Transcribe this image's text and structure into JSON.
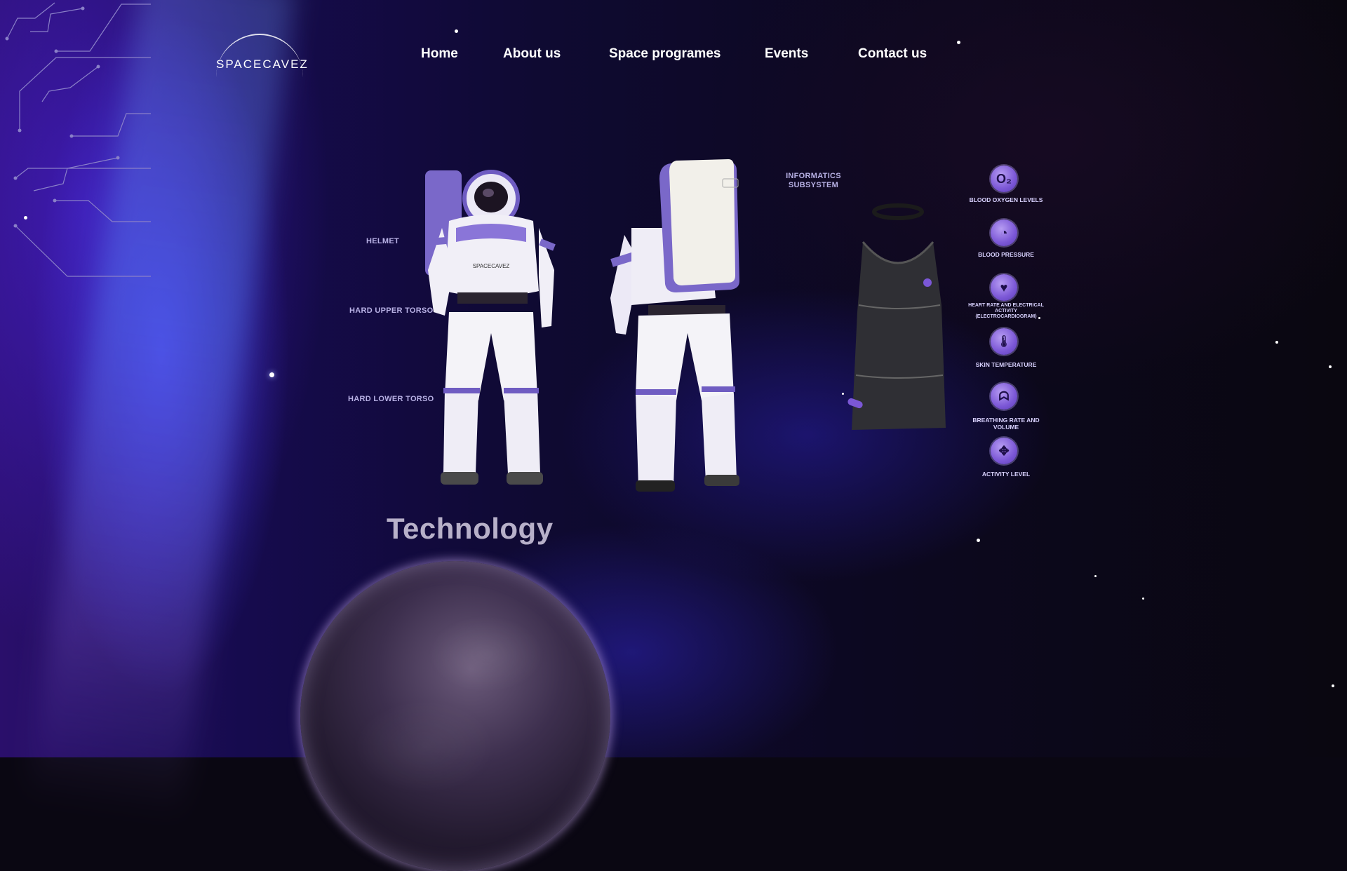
{
  "brand": {
    "logo_text": "SPACECAVEZ"
  },
  "nav": [
    {
      "label": "Home"
    },
    {
      "label": "About us"
    },
    {
      "label": "Space programes"
    },
    {
      "label": "Events"
    },
    {
      "label": "Contact us"
    }
  ],
  "suit_front": {
    "chest_text": "SPACECAVEZ",
    "labels": [
      "HELMET",
      "HARD UPPER TORSO",
      "HARD LOWER TORSO"
    ]
  },
  "suit_back": {
    "label": "INFORMATICS SUBSYSTEM"
  },
  "shirt_sensors": [
    {
      "icon": "o2-icon",
      "glyph": "O₂",
      "label": "BLOOD OXYGEN LEVELS"
    },
    {
      "icon": "gauge-icon",
      "glyph": "◔",
      "label": "BLOOD PRESSURE"
    },
    {
      "icon": "heart-icon",
      "glyph": "♥",
      "label": "HEART RATE AND ELECTRICAL ACTIVITY (ELECTROCARDIOGRAM)"
    },
    {
      "icon": "thermometer-icon",
      "glyph": "🌡",
      "label": "SKIN TEMPERATURE"
    },
    {
      "icon": "lungs-icon",
      "glyph": "ᗣ",
      "label": "BREATHING RATE AND VOLUME"
    },
    {
      "icon": "activity-icon",
      "glyph": "✥",
      "label": "ACTIVITY LEVEL"
    }
  ],
  "section": {
    "title": "Technology"
  },
  "colors": {
    "accent": "#7b57d6",
    "label": "#b9b2e6"
  }
}
